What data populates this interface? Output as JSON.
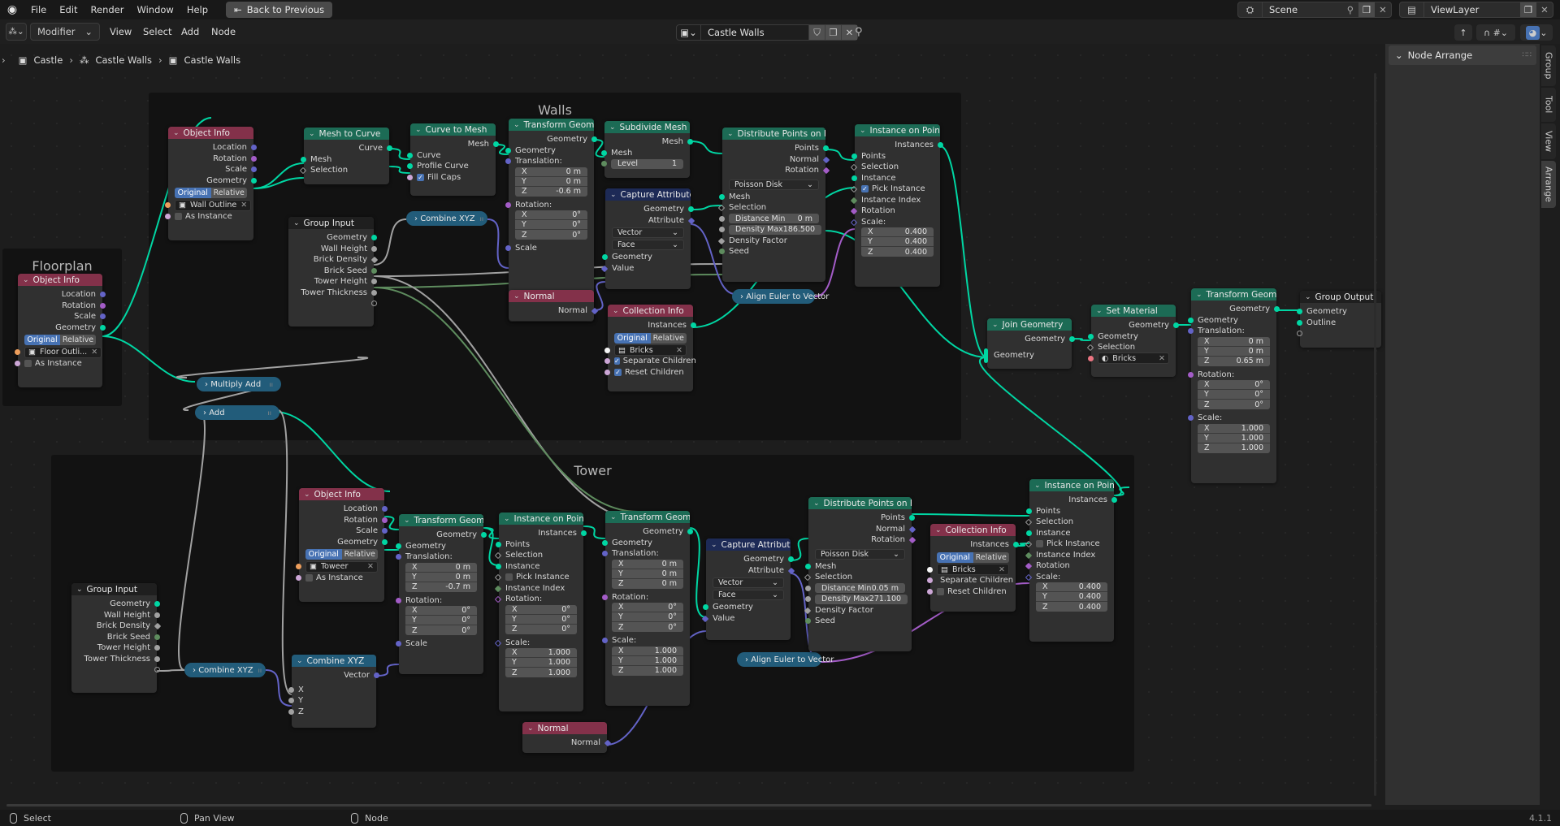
{
  "topbar": {
    "menus": [
      "File",
      "Edit",
      "Render",
      "Window",
      "Help"
    ],
    "back_button": "Back to Previous",
    "scene": "Scene",
    "view_layer": "ViewLayer"
  },
  "header": {
    "mode": "Modifier",
    "menus": [
      "View",
      "Select",
      "Add",
      "Node"
    ],
    "node_group": "Castle Walls"
  },
  "breadcrumb": [
    "Castle",
    "Castle Walls",
    "Castle Walls"
  ],
  "frames": {
    "walls": "Walls",
    "tower": "Tower",
    "floorplan": "Floorplan"
  },
  "labels": {
    "object_info": "Object Info",
    "mesh_to_curve": "Mesh to Curve",
    "curve_to_mesh": "Curve to Mesh",
    "transform_geometry": "Transform Geometry",
    "subdivide_mesh": "Subdivide Mesh",
    "distribute_points": "Distribute Points on Faces",
    "instance_on_points": "Instance on Points",
    "capture_attribute": "Capture Attribute",
    "collection_info": "Collection Info",
    "normal": "Normal",
    "group_input": "Group Input",
    "group_output": "Group Output",
    "combine_xyz": "Combine XYZ",
    "align_euler": "Align Euler to Vector",
    "multiply_add": "Multiply Add",
    "add": "Add",
    "join_geometry": "Join Geometry",
    "set_material": "Set Material",
    "location": "Location",
    "rotation": "Rotation",
    "scale": "Scale",
    "geometry": "Geometry",
    "original": "Original",
    "relative": "Relative",
    "as_instance": "As Instance",
    "curve": "Curve",
    "mesh": "Mesh",
    "selection": "Selection",
    "profile_curve": "Profile Curve",
    "fill_caps": "Fill Caps",
    "translation": "Translation:",
    "rotation_c": "Rotation:",
    "scale_c": "Scale:",
    "x": "X",
    "y": "Y",
    "z": "Z",
    "level": "Level",
    "points": "Points",
    "normal_s": "Normal",
    "poisson": "Poisson Disk",
    "distance_min": "Distance Min",
    "density_max": "Density Max",
    "density_factor": "Density Factor",
    "seed": "Seed",
    "instances": "Instances",
    "instance": "Instance",
    "pick_instance": "Pick Instance",
    "instance_index": "Instance Index",
    "attribute": "Attribute",
    "vector": "Vector",
    "face": "Face",
    "value": "Value",
    "separate_children": "Separate Children",
    "reset_children": "Reset Children",
    "wall_height": "Wall Height",
    "brick_density": "Brick Density",
    "brick_seed": "Brick Seed",
    "tower_height": "Tower Height",
    "tower_thickness": "Tower Thickness",
    "outline": "Outline"
  },
  "walls": {
    "object_info": {
      "object": "Wall Outline",
      "mode": "Original",
      "as_instance": false
    },
    "curve_to_mesh": {
      "fill_caps": true
    },
    "transform": {
      "translation": [
        "0 m",
        "0 m",
        "-0.6 m"
      ],
      "rotation": [
        "0°",
        "0°",
        "0°"
      ]
    },
    "subdivide": {
      "level": "1"
    },
    "distribute": {
      "method": "Poisson Disk",
      "distance_min": "0 m",
      "density_max": "186.500"
    },
    "capture": {
      "type": "Vector",
      "domain": "Face"
    },
    "instance": {
      "pick_instance": true,
      "scale": [
        "0.400",
        "0.400",
        "0.400"
      ]
    },
    "collection": {
      "collection": "Bricks",
      "mode": "Original",
      "separate_children": true,
      "reset_children": true
    }
  },
  "floorplan": {
    "object": "Floor Outli...",
    "mode": "Original",
    "as_instance": false
  },
  "tower": {
    "object_info": {
      "object": "Toweer",
      "mode": "Original",
      "as_instance": false
    },
    "transform1": {
      "translation": [
        "0 m",
        "0 m",
        "-0.7 m"
      ],
      "rotation": [
        "0°",
        "0°",
        "0°"
      ]
    },
    "instance1": {
      "pick_instance": false,
      "rotation": [
        "0°",
        "0°",
        "0°"
      ],
      "scale": [
        "1.000",
        "1.000",
        "1.000"
      ]
    },
    "transform2": {
      "translation": [
        "0 m",
        "0 m",
        "0 m"
      ],
      "rotation": [
        "0°",
        "0°",
        "0°"
      ],
      "scale": [
        "1.000",
        "1.000",
        "1.000"
      ]
    },
    "capture": {
      "type": "Vector",
      "domain": "Face"
    },
    "distribute": {
      "method": "Poisson Disk",
      "distance_min": "0.05 m",
      "density_max": "271.100"
    },
    "collection": {
      "collection": "Bricks",
      "mode": "Original",
      "separate_children": false,
      "reset_children": false
    },
    "instance2": {
      "pick_instance": false,
      "scale": [
        "0.400",
        "0.400",
        "0.400"
      ]
    }
  },
  "output": {
    "material": "Bricks",
    "transform": {
      "translation": [
        "0 m",
        "0 m",
        "0.65 m"
      ],
      "rotation": [
        "0°",
        "0°",
        "0°"
      ],
      "scale": [
        "1.000",
        "1.000",
        "1.000"
      ]
    }
  },
  "sidebar": {
    "panel": "Node Arrange",
    "tabs": [
      "Group",
      "Tool",
      "View",
      "Arrange"
    ],
    "active_tab": "Arrange"
  },
  "status": {
    "select": "Select",
    "pan": "Pan View",
    "node": "Node",
    "version": "4.1.1"
  },
  "colors": {
    "geometry": "#00d6a3",
    "vector": "#6363c7",
    "accent": "#4772b3",
    "geo_header": "#1c6b55",
    "input_header": "#83314a"
  }
}
